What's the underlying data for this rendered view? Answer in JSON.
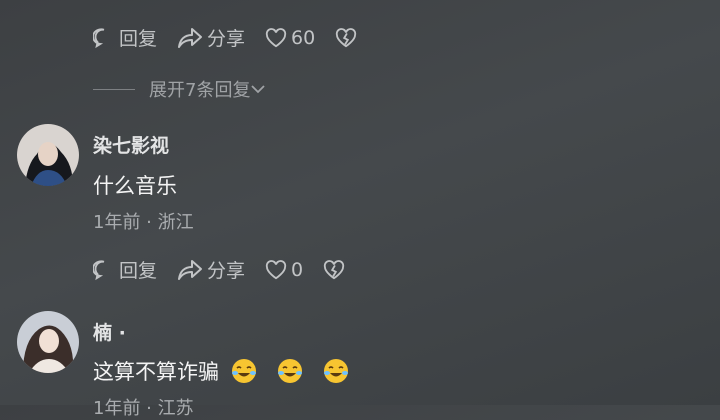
{
  "comment_prev": {
    "reply_label": "回复",
    "share_label": "分享",
    "like_count": "60"
  },
  "expand": {
    "label": "展开7条回复"
  },
  "comment_1": {
    "username": "染七影视",
    "text": "什么音乐",
    "meta": "1年前 · 浙江",
    "reply_label": "回复",
    "share_label": "分享",
    "like_count": "0"
  },
  "comment_2": {
    "username": "楠 ·",
    "text": "这算不算诈骗",
    "meta": "1年前 · 江苏",
    "emojis": [
      "crying-laughing-emoji",
      "crying-laughing-emoji",
      "crying-laughing-emoji"
    ]
  },
  "colors": {
    "background": "#404346",
    "text_primary": "#f4f4f4",
    "text_secondary": "#a9acaf"
  }
}
